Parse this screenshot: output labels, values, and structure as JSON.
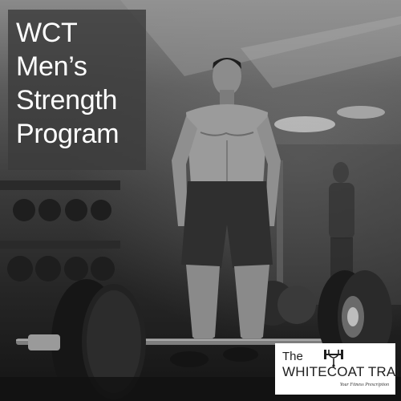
{
  "title": {
    "lines": [
      "WCT",
      "Men’s",
      "Strength",
      "Program"
    ]
  },
  "logo": {
    "the": "The",
    "name": "WHITECOAT TRAINER",
    "tagline": "Your Fitness Prescription",
    "icon": "stethoscope-dumbbell-icon"
  },
  "colors": {
    "title_box": "#3c3c3c",
    "title_text": "#ffffff",
    "logo_bg": "#ffffff",
    "logo_text": "#1e1e1e"
  }
}
